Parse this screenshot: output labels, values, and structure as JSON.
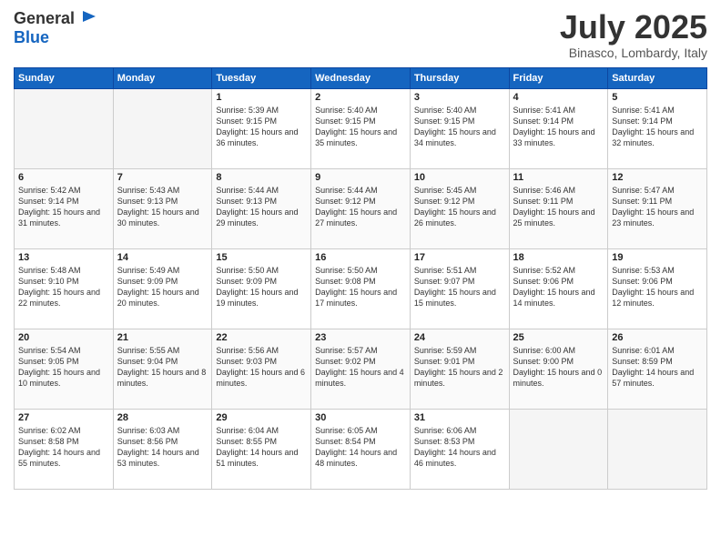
{
  "header": {
    "logo_line1": "General",
    "logo_line2": "Blue",
    "month_title": "July 2025",
    "location": "Binasco, Lombardy, Italy"
  },
  "weekdays": [
    "Sunday",
    "Monday",
    "Tuesday",
    "Wednesday",
    "Thursday",
    "Friday",
    "Saturday"
  ],
  "weeks": [
    [
      {
        "day": "",
        "info": ""
      },
      {
        "day": "",
        "info": ""
      },
      {
        "day": "1",
        "info": "Sunrise: 5:39 AM\nSunset: 9:15 PM\nDaylight: 15 hours and 36 minutes."
      },
      {
        "day": "2",
        "info": "Sunrise: 5:40 AM\nSunset: 9:15 PM\nDaylight: 15 hours and 35 minutes."
      },
      {
        "day": "3",
        "info": "Sunrise: 5:40 AM\nSunset: 9:15 PM\nDaylight: 15 hours and 34 minutes."
      },
      {
        "day": "4",
        "info": "Sunrise: 5:41 AM\nSunset: 9:14 PM\nDaylight: 15 hours and 33 minutes."
      },
      {
        "day": "5",
        "info": "Sunrise: 5:41 AM\nSunset: 9:14 PM\nDaylight: 15 hours and 32 minutes."
      }
    ],
    [
      {
        "day": "6",
        "info": "Sunrise: 5:42 AM\nSunset: 9:14 PM\nDaylight: 15 hours and 31 minutes."
      },
      {
        "day": "7",
        "info": "Sunrise: 5:43 AM\nSunset: 9:13 PM\nDaylight: 15 hours and 30 minutes."
      },
      {
        "day": "8",
        "info": "Sunrise: 5:44 AM\nSunset: 9:13 PM\nDaylight: 15 hours and 29 minutes."
      },
      {
        "day": "9",
        "info": "Sunrise: 5:44 AM\nSunset: 9:12 PM\nDaylight: 15 hours and 27 minutes."
      },
      {
        "day": "10",
        "info": "Sunrise: 5:45 AM\nSunset: 9:12 PM\nDaylight: 15 hours and 26 minutes."
      },
      {
        "day": "11",
        "info": "Sunrise: 5:46 AM\nSunset: 9:11 PM\nDaylight: 15 hours and 25 minutes."
      },
      {
        "day": "12",
        "info": "Sunrise: 5:47 AM\nSunset: 9:11 PM\nDaylight: 15 hours and 23 minutes."
      }
    ],
    [
      {
        "day": "13",
        "info": "Sunrise: 5:48 AM\nSunset: 9:10 PM\nDaylight: 15 hours and 22 minutes."
      },
      {
        "day": "14",
        "info": "Sunrise: 5:49 AM\nSunset: 9:09 PM\nDaylight: 15 hours and 20 minutes."
      },
      {
        "day": "15",
        "info": "Sunrise: 5:50 AM\nSunset: 9:09 PM\nDaylight: 15 hours and 19 minutes."
      },
      {
        "day": "16",
        "info": "Sunrise: 5:50 AM\nSunset: 9:08 PM\nDaylight: 15 hours and 17 minutes."
      },
      {
        "day": "17",
        "info": "Sunrise: 5:51 AM\nSunset: 9:07 PM\nDaylight: 15 hours and 15 minutes."
      },
      {
        "day": "18",
        "info": "Sunrise: 5:52 AM\nSunset: 9:06 PM\nDaylight: 15 hours and 14 minutes."
      },
      {
        "day": "19",
        "info": "Sunrise: 5:53 AM\nSunset: 9:06 PM\nDaylight: 15 hours and 12 minutes."
      }
    ],
    [
      {
        "day": "20",
        "info": "Sunrise: 5:54 AM\nSunset: 9:05 PM\nDaylight: 15 hours and 10 minutes."
      },
      {
        "day": "21",
        "info": "Sunrise: 5:55 AM\nSunset: 9:04 PM\nDaylight: 15 hours and 8 minutes."
      },
      {
        "day": "22",
        "info": "Sunrise: 5:56 AM\nSunset: 9:03 PM\nDaylight: 15 hours and 6 minutes."
      },
      {
        "day": "23",
        "info": "Sunrise: 5:57 AM\nSunset: 9:02 PM\nDaylight: 15 hours and 4 minutes."
      },
      {
        "day": "24",
        "info": "Sunrise: 5:59 AM\nSunset: 9:01 PM\nDaylight: 15 hours and 2 minutes."
      },
      {
        "day": "25",
        "info": "Sunrise: 6:00 AM\nSunset: 9:00 PM\nDaylight: 15 hours and 0 minutes."
      },
      {
        "day": "26",
        "info": "Sunrise: 6:01 AM\nSunset: 8:59 PM\nDaylight: 14 hours and 57 minutes."
      }
    ],
    [
      {
        "day": "27",
        "info": "Sunrise: 6:02 AM\nSunset: 8:58 PM\nDaylight: 14 hours and 55 minutes."
      },
      {
        "day": "28",
        "info": "Sunrise: 6:03 AM\nSunset: 8:56 PM\nDaylight: 14 hours and 53 minutes."
      },
      {
        "day": "29",
        "info": "Sunrise: 6:04 AM\nSunset: 8:55 PM\nDaylight: 14 hours and 51 minutes."
      },
      {
        "day": "30",
        "info": "Sunrise: 6:05 AM\nSunset: 8:54 PM\nDaylight: 14 hours and 48 minutes."
      },
      {
        "day": "31",
        "info": "Sunrise: 6:06 AM\nSunset: 8:53 PM\nDaylight: 14 hours and 46 minutes."
      },
      {
        "day": "",
        "info": ""
      },
      {
        "day": "",
        "info": ""
      }
    ]
  ]
}
